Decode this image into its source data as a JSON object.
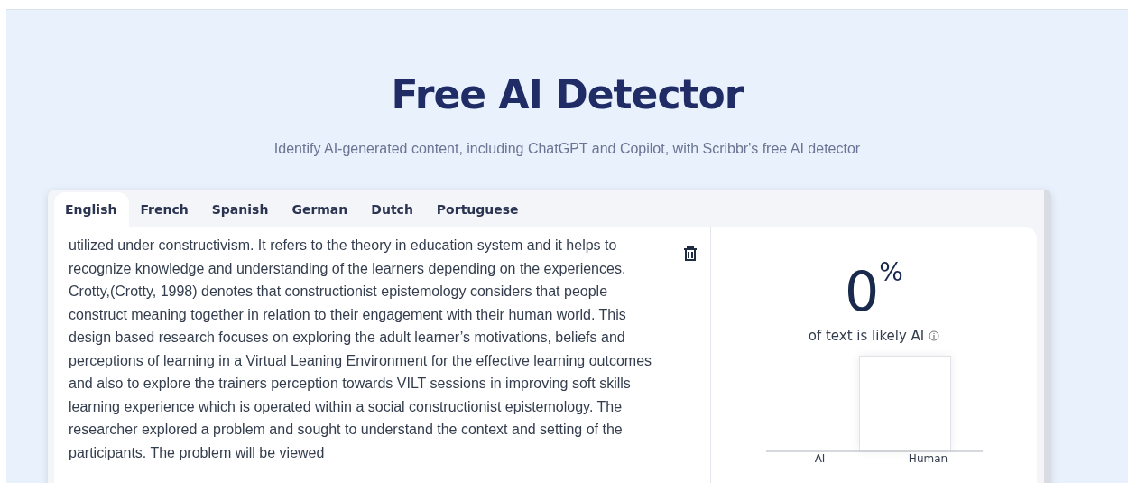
{
  "header": {
    "title": "Free AI Detector",
    "subtitle": "Identify AI-generated content, including ChatGPT and Copilot, with Scribbr's free AI detector"
  },
  "tabs": [
    {
      "label": "English",
      "selected": true
    },
    {
      "label": "French",
      "selected": false
    },
    {
      "label": "Spanish",
      "selected": false
    },
    {
      "label": "German",
      "selected": false
    },
    {
      "label": "Dutch",
      "selected": false
    },
    {
      "label": "Portuguese",
      "selected": false
    }
  ],
  "input_text": "utilized under constructivism. It refers to the theory in education system and it helps to recognize knowledge and understanding of the learners depending on the experiences. Crotty,(Crotty, 1998) denotes that constructionist epistemology considers that people construct meaning together in relation to their engagement with their human world. This design based research focuses on exploring the adult learner’s motivations, beliefs and perceptions of learning in a Virtual Leaning Environment for the effective learning outcomes and also to explore the trainers perception towards VILT sessions in improving soft skills learning experience which is operated within a social constructionist epistemology. The researcher explored a problem and sought to understand the context and setting of the participants. The problem will be viewed",
  "result": {
    "score": "0",
    "unit": "%",
    "caption": "of text is likely AI",
    "bar_labels": [
      "AI",
      "Human"
    ]
  }
}
